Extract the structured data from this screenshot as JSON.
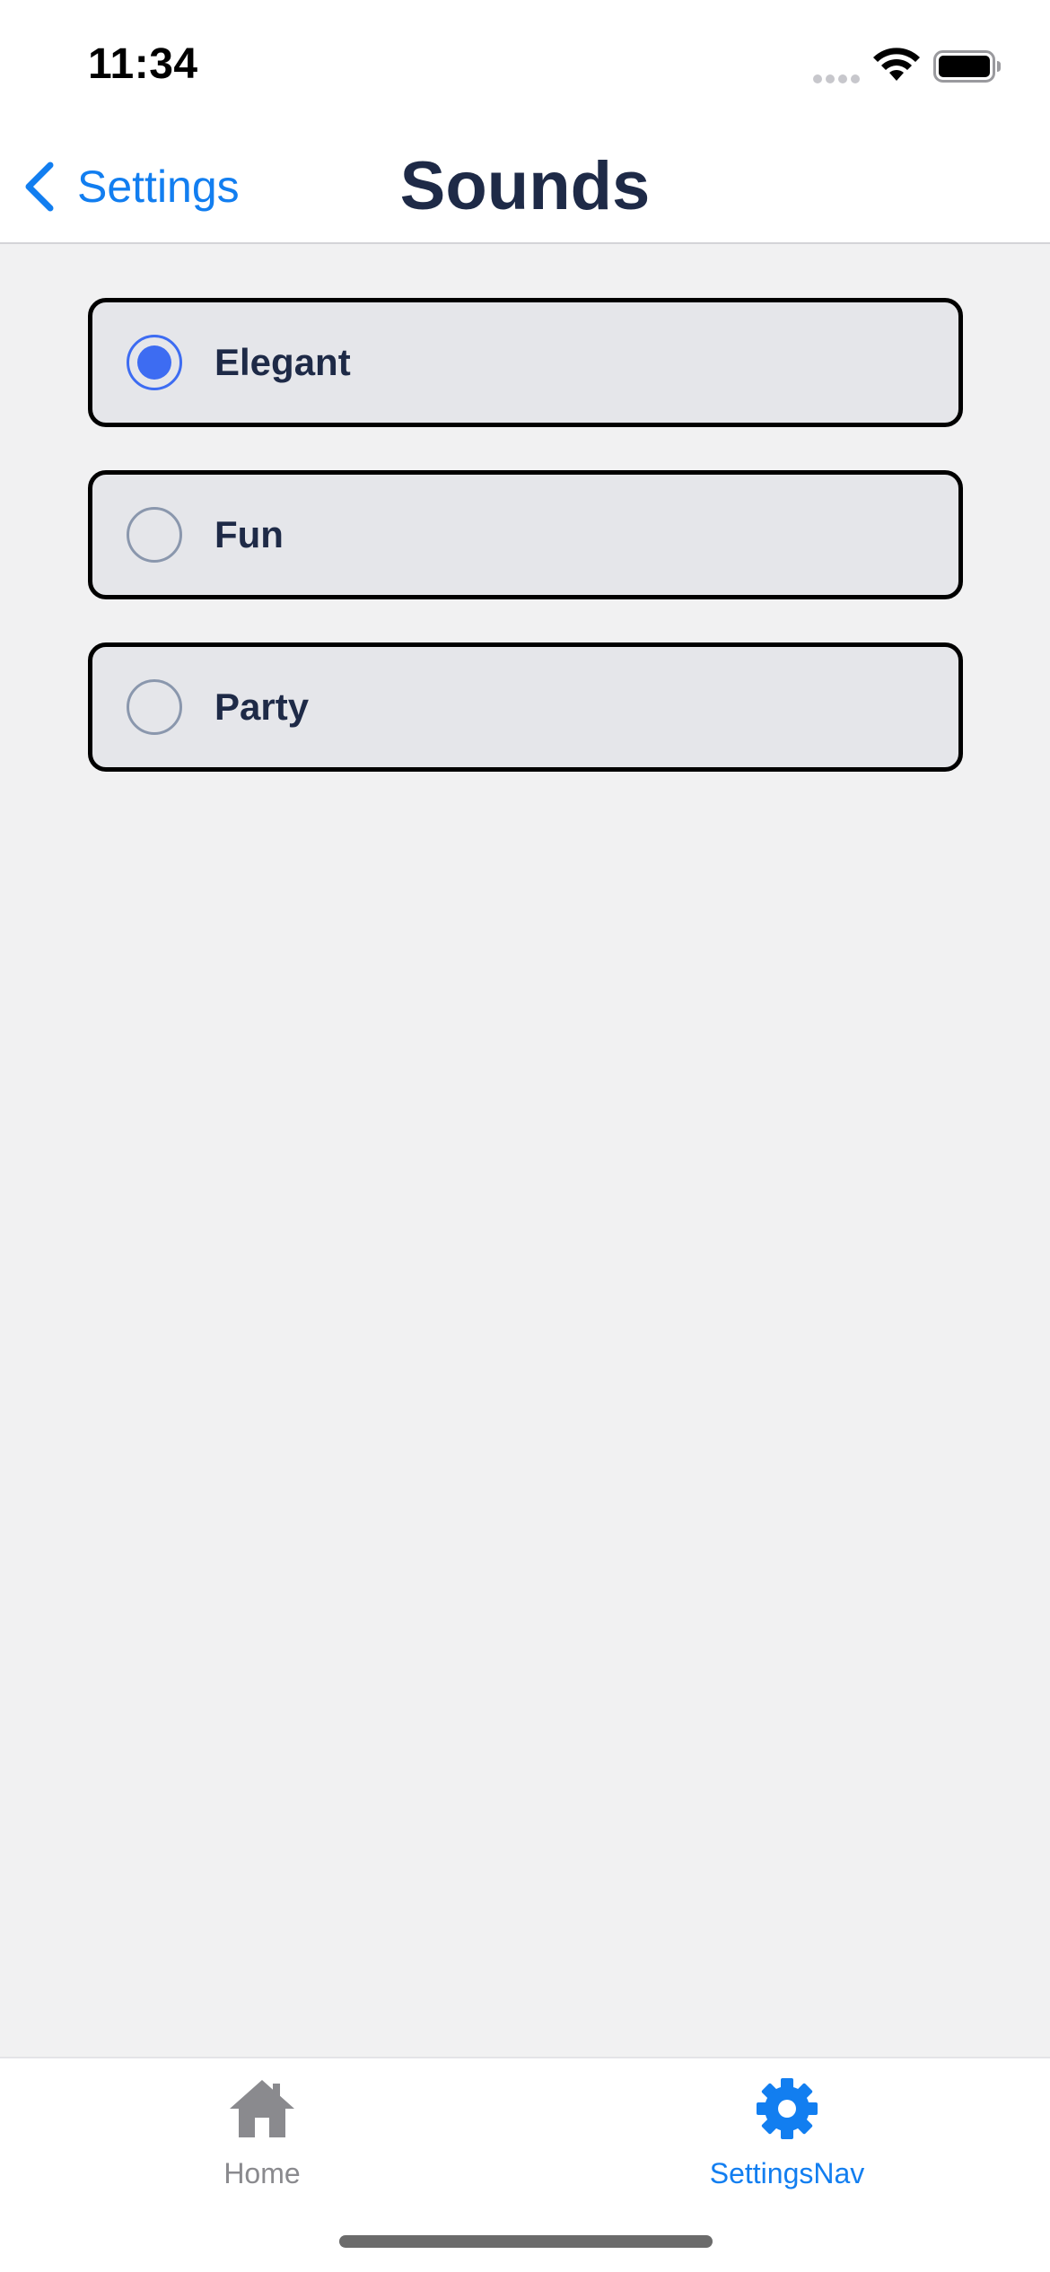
{
  "status_bar": {
    "time": "11:34"
  },
  "nav": {
    "back_label": "Settings",
    "title": "Sounds"
  },
  "options": [
    {
      "label": "Elegant",
      "selected": true
    },
    {
      "label": "Fun",
      "selected": false
    },
    {
      "label": "Party",
      "selected": false
    }
  ],
  "tab_bar": {
    "tabs": [
      {
        "label": "Home",
        "icon": "home-icon",
        "active": false
      },
      {
        "label": "SettingsNav",
        "icon": "gear-icon",
        "active": true
      }
    ]
  },
  "colors": {
    "accent": "#127ef0",
    "radio_selected": "#3d6cf2",
    "title_text": "#1e2a47",
    "background": "#f1f1f2",
    "card_background": "#e5e6ea"
  }
}
